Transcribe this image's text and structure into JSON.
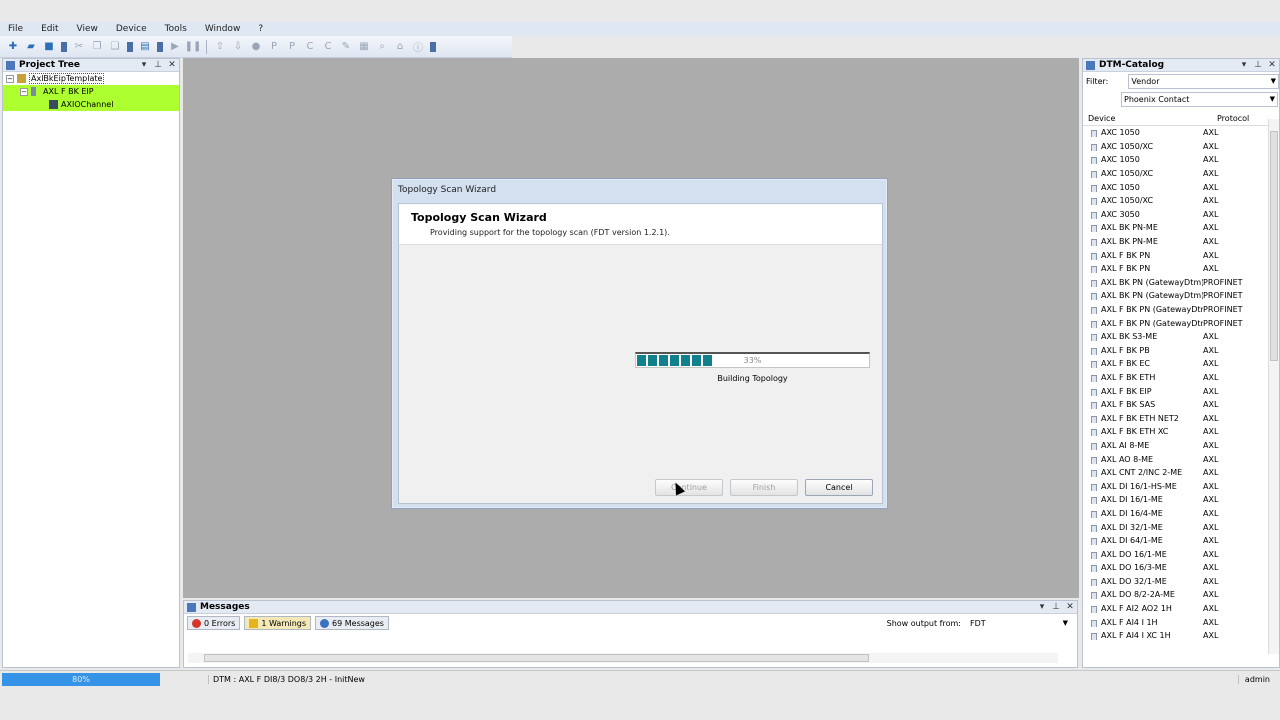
{
  "menu": [
    "File",
    "Edit",
    "View",
    "Device",
    "Tools",
    "Window",
    "?"
  ],
  "project_tree": {
    "title": "Project Tree",
    "items": [
      {
        "label": "AxlBkEipTemplate",
        "level": 0
      },
      {
        "label": "AXL F BK EIP",
        "level": 1
      },
      {
        "label": "AXIOChannel",
        "level": 2
      }
    ]
  },
  "dialog": {
    "window_title": "Topology Scan Wizard",
    "heading": "Topology Scan Wizard",
    "subheading": "Providing support for the topology scan (FDT version 1.2.1).",
    "progress_percent": 33,
    "progress_label": "33%",
    "progress_status": "Building Topology",
    "buttons": {
      "continue": "Continue",
      "finish": "Finish",
      "cancel": "Cancel"
    }
  },
  "catalog": {
    "title": "DTM-Catalog",
    "filter_label": "Filter:",
    "filter_value": "Vendor",
    "vendor_value": "Phoenix Contact",
    "col_device": "Device",
    "col_protocol": "Protocol",
    "rows": [
      {
        "device": "AXC 1050",
        "protocol": "AXL"
      },
      {
        "device": "AXC 1050/XC",
        "protocol": "AXL"
      },
      {
        "device": "AXC 1050",
        "protocol": "AXL"
      },
      {
        "device": "AXC 1050/XC",
        "protocol": "AXL"
      },
      {
        "device": "AXC 1050",
        "protocol": "AXL"
      },
      {
        "device": "AXC 1050/XC",
        "protocol": "AXL"
      },
      {
        "device": "AXC 3050",
        "protocol": "AXL"
      },
      {
        "device": "AXL BK PN-ME",
        "protocol": "AXL"
      },
      {
        "device": "AXL BK PN-ME",
        "protocol": "AXL"
      },
      {
        "device": "AXL F BK PN",
        "protocol": "AXL"
      },
      {
        "device": "AXL F BK PN",
        "protocol": "AXL"
      },
      {
        "device": "AXL BK PN (GatewayDtm)",
        "protocol": "PROFINET"
      },
      {
        "device": "AXL BK PN (GatewayDtm)",
        "protocol": "PROFINET"
      },
      {
        "device": "AXL F BK PN (GatewayDtm)",
        "protocol": "PROFINET"
      },
      {
        "device": "AXL F BK PN (GatewayDtm)",
        "protocol": "PROFINET"
      },
      {
        "device": "AXL BK S3-ME",
        "protocol": "AXL"
      },
      {
        "device": "AXL F BK PB",
        "protocol": "AXL"
      },
      {
        "device": "AXL F BK EC",
        "protocol": "AXL"
      },
      {
        "device": "AXL F BK ETH",
        "protocol": "AXL"
      },
      {
        "device": "AXL F BK EIP",
        "protocol": "AXL"
      },
      {
        "device": "AXL F BK SAS",
        "protocol": "AXL"
      },
      {
        "device": "AXL F BK ETH NET2",
        "protocol": "AXL"
      },
      {
        "device": "AXL F BK ETH XC",
        "protocol": "AXL"
      },
      {
        "device": "AXL AI 8-ME",
        "protocol": "AXL"
      },
      {
        "device": "AXL AO 8-ME",
        "protocol": "AXL"
      },
      {
        "device": "AXL CNT 2/INC 2-ME",
        "protocol": "AXL"
      },
      {
        "device": "AXL DI 16/1-HS-ME",
        "protocol": "AXL"
      },
      {
        "device": "AXL DI 16/1-ME",
        "protocol": "AXL"
      },
      {
        "device": "AXL DI 16/4-ME",
        "protocol": "AXL"
      },
      {
        "device": "AXL DI 32/1-ME",
        "protocol": "AXL"
      },
      {
        "device": "AXL DI 64/1-ME",
        "protocol": "AXL"
      },
      {
        "device": "AXL DO 16/1-ME",
        "protocol": "AXL"
      },
      {
        "device": "AXL DO 16/3-ME",
        "protocol": "AXL"
      },
      {
        "device": "AXL DO 32/1-ME",
        "protocol": "AXL"
      },
      {
        "device": "AXL DO 8/2-2A-ME",
        "protocol": "AXL"
      },
      {
        "device": "AXL F AI2 AO2 1H",
        "protocol": "AXL"
      },
      {
        "device": "AXL F AI4 I 1H",
        "protocol": "AXL"
      },
      {
        "device": "AXL F AI4 I XC 1H",
        "protocol": "AXL"
      }
    ]
  },
  "messages": {
    "title": "Messages",
    "errors": "0 Errors",
    "warnings": "1 Warnings",
    "messages": "69 Messages",
    "output_label": "Show output from:",
    "output_value": "FDT"
  },
  "status": {
    "progress_label": "80%",
    "progress_fraction": 0.8,
    "text": "DTM : AXL F DI8/3 DO8/3 2H - InitNew",
    "user": "admin"
  },
  "colors": {
    "selection": "#adff2f",
    "progress": "#10808c",
    "status_progress": "#3593e8"
  }
}
